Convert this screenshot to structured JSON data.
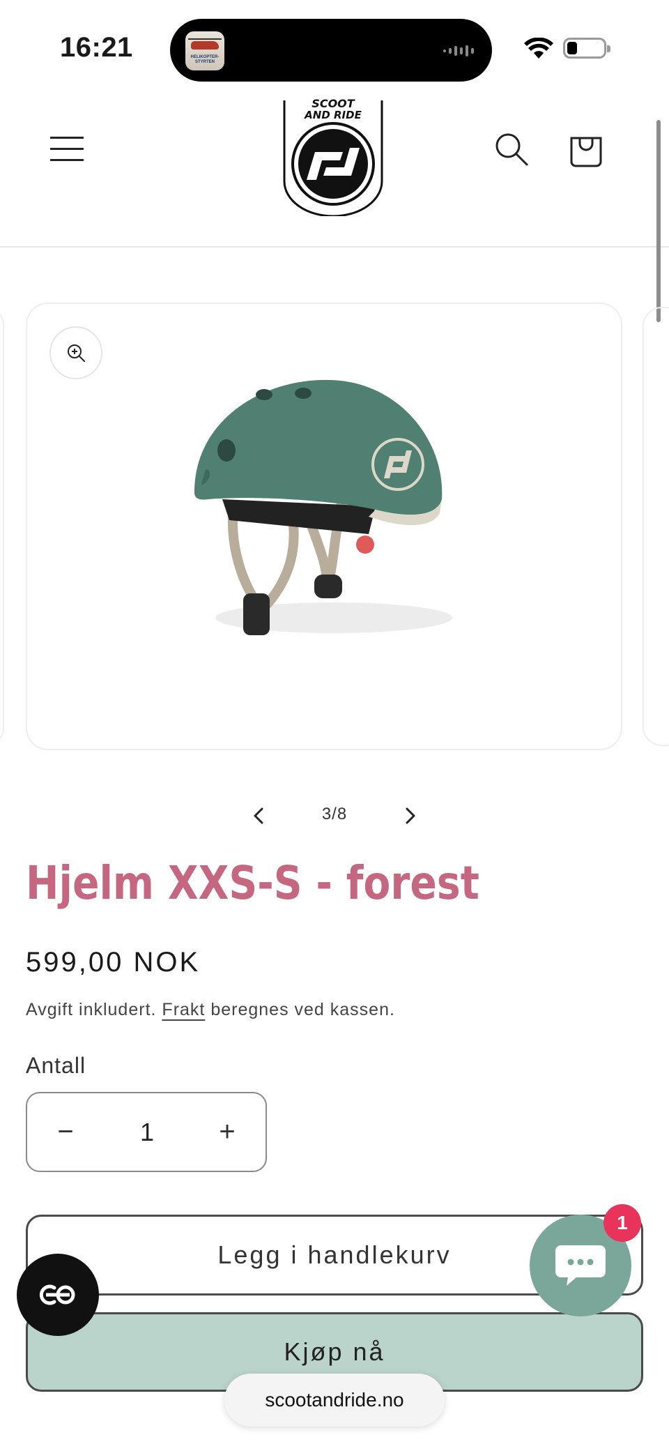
{
  "status_bar": {
    "time": "16:21",
    "island_app_text": "HELIKOPTER-STYRTEN"
  },
  "header": {
    "logo_text": "SCOOT AND RIDE",
    "menu_icon": "hamburger-icon",
    "search_icon": "search-icon",
    "cart_icon": "cart-icon"
  },
  "gallery": {
    "counter": "3/8",
    "zoom_icon": "zoom-in-icon",
    "image": "green-helmet-photo"
  },
  "product": {
    "title": "Hjelm XXS-S - forest",
    "price": "599,00 NOK",
    "tax_prefix": "Avgift inkludert.",
    "shipping_link": "Frakt",
    "tax_suffix": "beregnes ved kassen.",
    "quantity_label": "Antall",
    "quantity_value": "1",
    "minus": "−",
    "plus": "+",
    "add_to_cart": "Legg i handlekurv",
    "buy_now": "Kjøp nå"
  },
  "chat": {
    "badge_count": "1"
  },
  "browser": {
    "url": "scootandride.no"
  },
  "colors": {
    "title": "#c56780",
    "buy_now_bg": "#bad3cb",
    "chat_bg": "#7aa79a",
    "badge": "#e8345a"
  }
}
